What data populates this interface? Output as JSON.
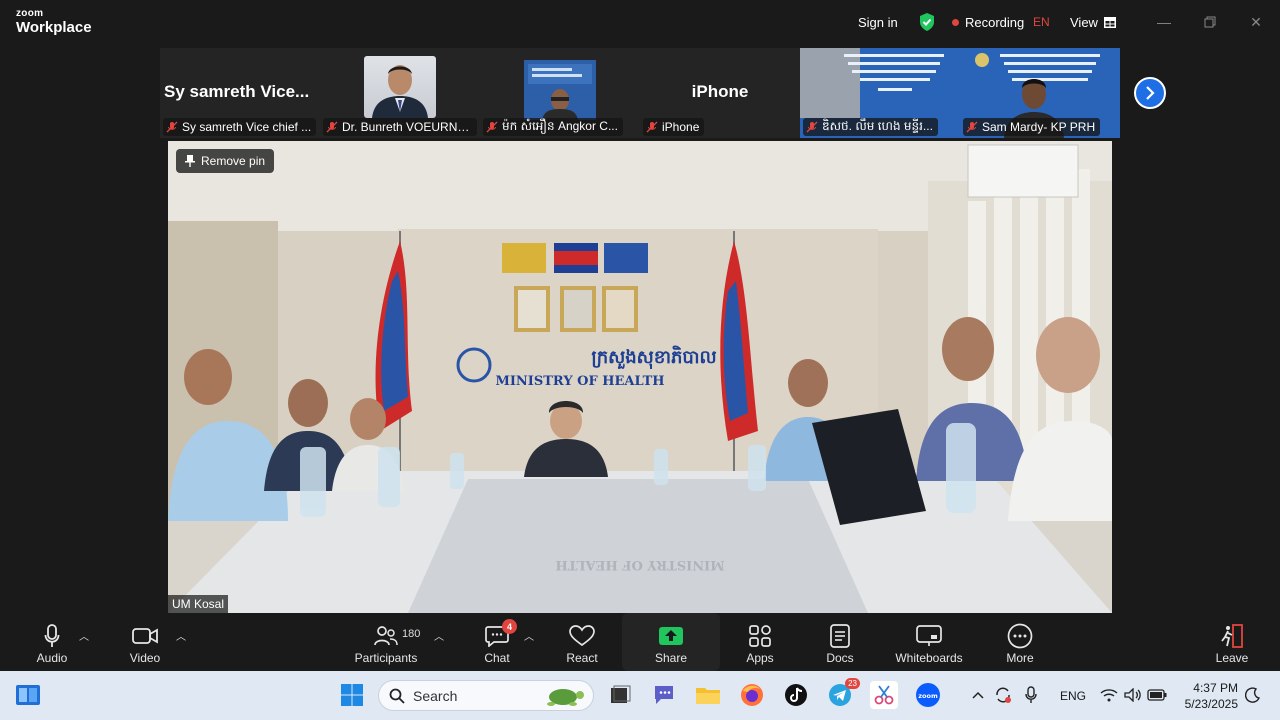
{
  "app": {
    "logo_line1": "zoom",
    "logo_line2": "Workplace",
    "sign_in": "Sign in",
    "recording_label": "Recording",
    "language": "EN",
    "view_label": "View",
    "accent_color": "#0b5cff",
    "recording_color": "#e0463f"
  },
  "thumbnails": [
    {
      "display_text": "Sy samreth  Vice...",
      "name": "Sy samreth Vice chief ...",
      "muted": true,
      "type": "name-only"
    },
    {
      "display_text": "",
      "name": "Dr. Bunreth VOEURNG...",
      "muted": true,
      "type": "portrait"
    },
    {
      "display_text": "",
      "name": "ម៉ក សំអឿន Angkor C...",
      "muted": true,
      "type": "video-small"
    },
    {
      "display_text": "iPhone",
      "name": "iPhone",
      "muted": true,
      "type": "name-only"
    },
    {
      "display_text": "",
      "name": "ឌិសថ. លឹម ហេង មន្ទីរ...",
      "muted": true,
      "type": "video-banner"
    },
    {
      "display_text": "",
      "name": "Sam Mardy- KP PRH",
      "muted": true,
      "type": "video-banner"
    }
  ],
  "main_video": {
    "remove_pin_label": "Remove pin",
    "speaker_name": "UM Kosal",
    "wall_text_khmer": "ក្រសួងសុខាភិបាល",
    "wall_text_english": "MINISTRY OF HEALTH"
  },
  "toolbar": {
    "audio": "Audio",
    "video": "Video",
    "participants": "Participants",
    "participants_count": "180",
    "chat": "Chat",
    "chat_badge": "4",
    "react": "React",
    "share": "Share",
    "apps": "Apps",
    "docs": "Docs",
    "whiteboards": "Whiteboards",
    "more": "More",
    "leave": "Leave",
    "share_color": "#21c55d",
    "leave_color": "#e0463f"
  },
  "taskbar": {
    "search_placeholder": "Search",
    "language": "ENG",
    "time": "4:37 PM",
    "date": "5/23/2025",
    "telegram_badge": "23"
  }
}
